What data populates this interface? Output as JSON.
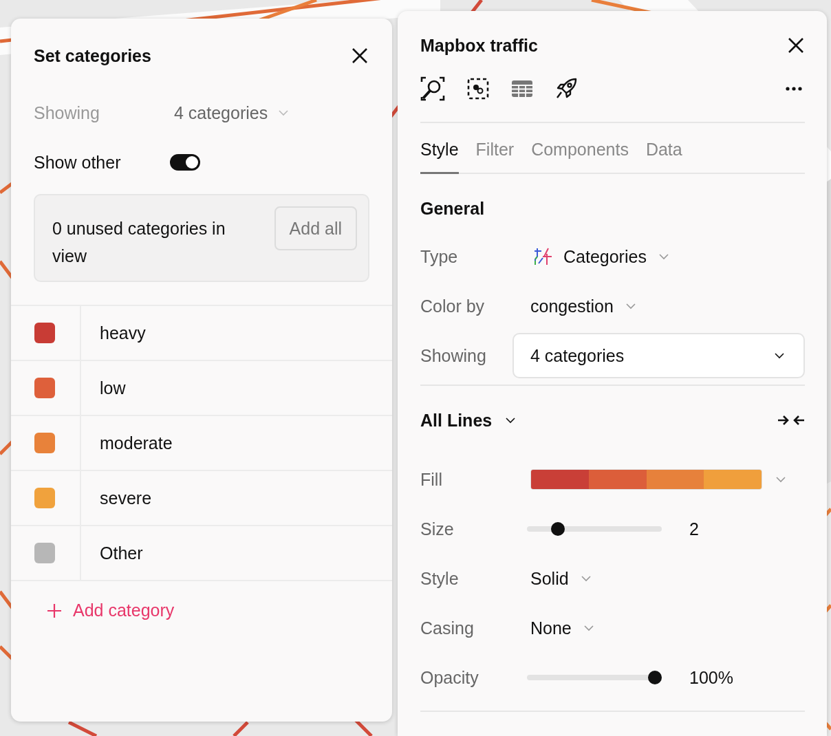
{
  "left_panel": {
    "title": "Set categories",
    "showing": {
      "label": "Showing",
      "value": "4 categories"
    },
    "show_other": {
      "label": "Show other",
      "on": true
    },
    "unused": {
      "text": "0 unused categories in view",
      "button": "Add all"
    },
    "categories": [
      {
        "name": "heavy",
        "color": "#c83c35"
      },
      {
        "name": "low",
        "color": "#de603b"
      },
      {
        "name": "moderate",
        "color": "#e8823a"
      },
      {
        "name": "severe",
        "color": "#f0a23d"
      },
      {
        "name": "Other",
        "color": "#b7b7b7"
      }
    ],
    "add_button": "Add category"
  },
  "right_panel": {
    "title": "Mapbox traffic",
    "tabs": [
      {
        "label": "Style",
        "selected": true
      },
      {
        "label": "Filter",
        "selected": false
      },
      {
        "label": "Components",
        "selected": false
      },
      {
        "label": "Data",
        "selected": false
      }
    ],
    "section": "General",
    "fields": [
      {
        "kind": "icon-select",
        "label": "Type",
        "value": "Categories"
      },
      {
        "kind": "select",
        "label": "Color by",
        "value": "congestion"
      },
      {
        "kind": "dropdown",
        "label": "Showing",
        "value": "4 categories"
      }
    ],
    "lines": {
      "title": "All Lines",
      "rows": [
        {
          "kind": "ramp",
          "label": "Fill",
          "segments": [
            {
              "color": "#c93f37"
            },
            {
              "color": "#dc5e3a"
            },
            {
              "color": "#e7813b"
            },
            {
              "color": "#f09f3c"
            }
          ]
        },
        {
          "kind": "slider",
          "label": "Size",
          "level": 0.23,
          "reading": "2"
        },
        {
          "kind": "select",
          "label": "Style",
          "value": "Solid"
        },
        {
          "kind": "select",
          "label": "Casing",
          "value": "None"
        },
        {
          "kind": "slider",
          "label": "Opacity",
          "level": 0.95,
          "reading": "100%"
        }
      ]
    }
  }
}
